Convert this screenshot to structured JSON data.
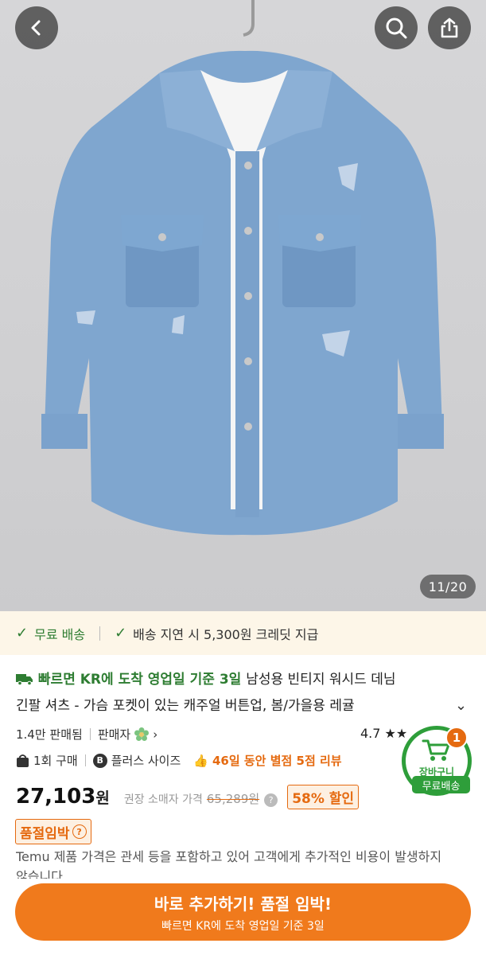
{
  "image": {
    "counter": "11/20"
  },
  "promo": {
    "free_shipping": "무료 배송",
    "delay_credit": "배송 지연 시 5,300원 크레딧 지급"
  },
  "product": {
    "shipping_prefix": "빠르면 KR에 도착 영업일 기준 3일",
    "title_part1": "남성용 빈티지 워시드 데님",
    "title_line2": "긴팔 셔츠 - 가슴 포켓이 있는 캐주얼 버튼업, 봄/가을용 레귤",
    "sold_count": "1.4만 판매됨",
    "seller": "판매자",
    "rating": "4.7 ★★",
    "buy_once": "1회 구매",
    "plus_size": "플러스 사이즈",
    "reviews": "46일 동안 별점 5점 리뷰",
    "price": "27,103",
    "price_unit": "원",
    "msrp_label": "권장 소매자 가격",
    "msrp_value": "65,289원",
    "discount": "58% 할인",
    "soldout": "품절임박",
    "notice": "Temu 제품 가격은 관세 등을 포함하고 있어 고객에게 추가적인 비용이 발생하지 않습니다"
  },
  "cart": {
    "badge": "1",
    "label": "장바구니",
    "free_shipping": "무료배송"
  },
  "cta": {
    "main": "바로 추가하기! 품절 임박!",
    "sub": "빠르면 KR에 도착 영업일 기준 3일"
  },
  "colors": {
    "green": "#2e7d32",
    "orange": "#e56a10",
    "cta": "#f07a1c"
  }
}
